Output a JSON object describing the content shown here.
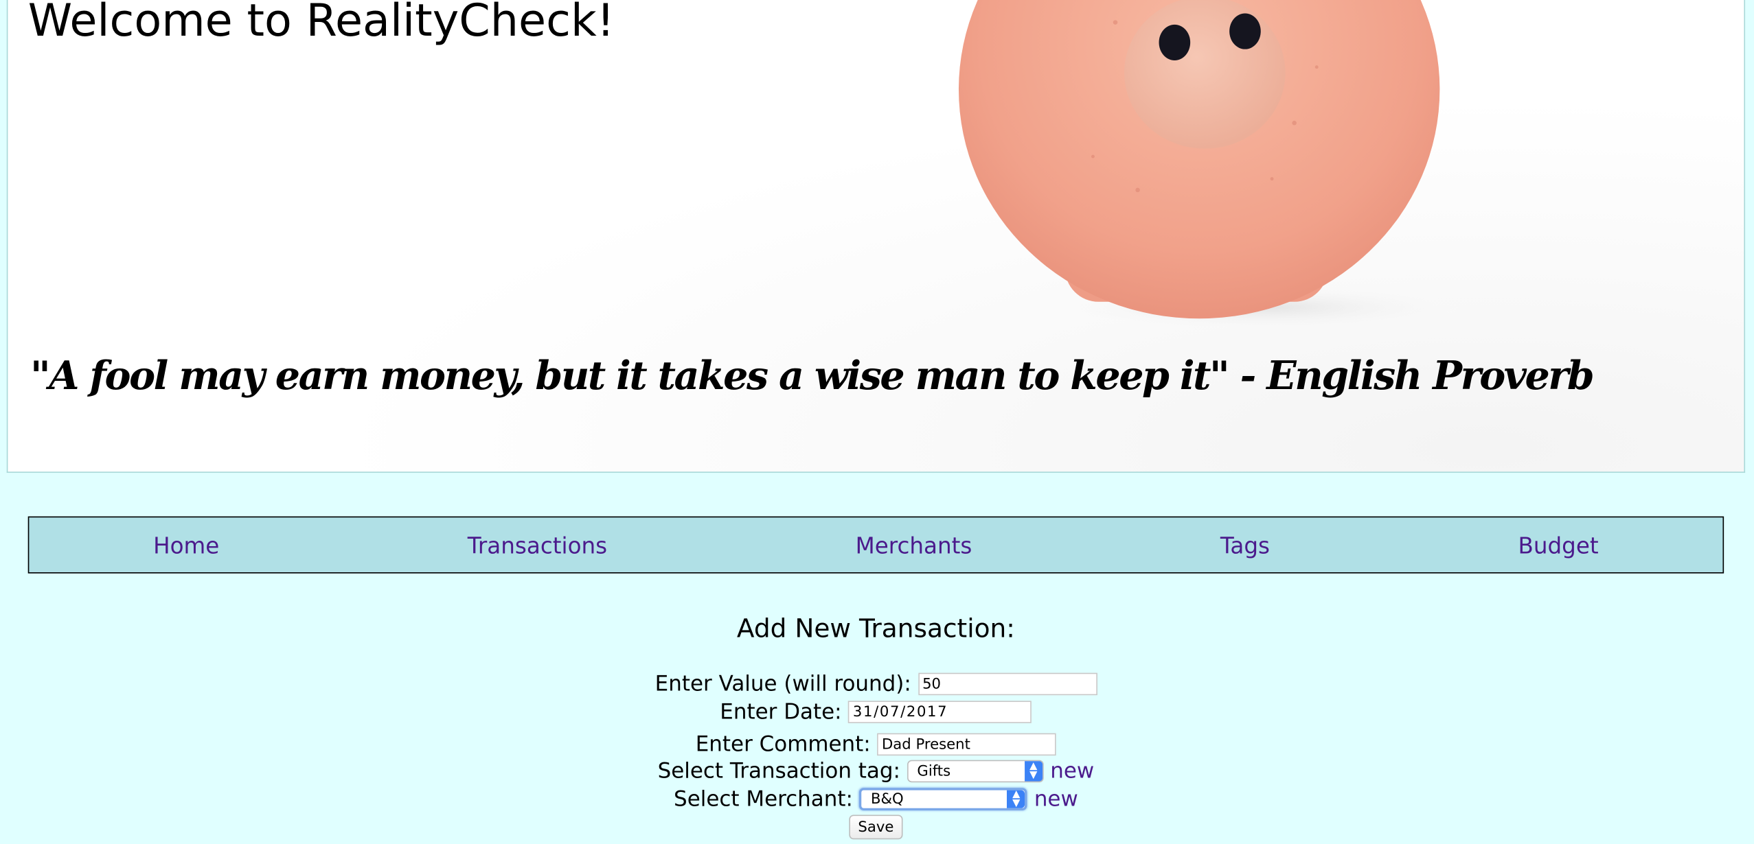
{
  "hero": {
    "title": "Welcome to RealityCheck!",
    "quote": "\"A fool may earn money, but it takes a wise man to keep it\" - English Proverb"
  },
  "nav": {
    "items": [
      {
        "label": "Home"
      },
      {
        "label": "Transactions"
      },
      {
        "label": "Merchants"
      },
      {
        "label": "Tags"
      },
      {
        "label": "Budget"
      }
    ]
  },
  "form": {
    "title": "Add New Transaction:",
    "value_label": "Enter Value (will round):",
    "value": "50",
    "date_label": "Enter Date:",
    "date": "31/07/2017",
    "comment_label": "Enter Comment:",
    "comment": "Dad Present",
    "tag_label": "Select Transaction tag:",
    "tag_selected": "Gifts",
    "tag_new_link": "new",
    "merchant_label": "Select Merchant:",
    "merchant_selected": "B&Q",
    "merchant_new_link": "new",
    "save_label": "Save"
  },
  "colors": {
    "page_background": "#e0ffff",
    "nav_background": "#b0e0e6",
    "link": "#4b1a8c",
    "pig": "#f3a98f"
  }
}
